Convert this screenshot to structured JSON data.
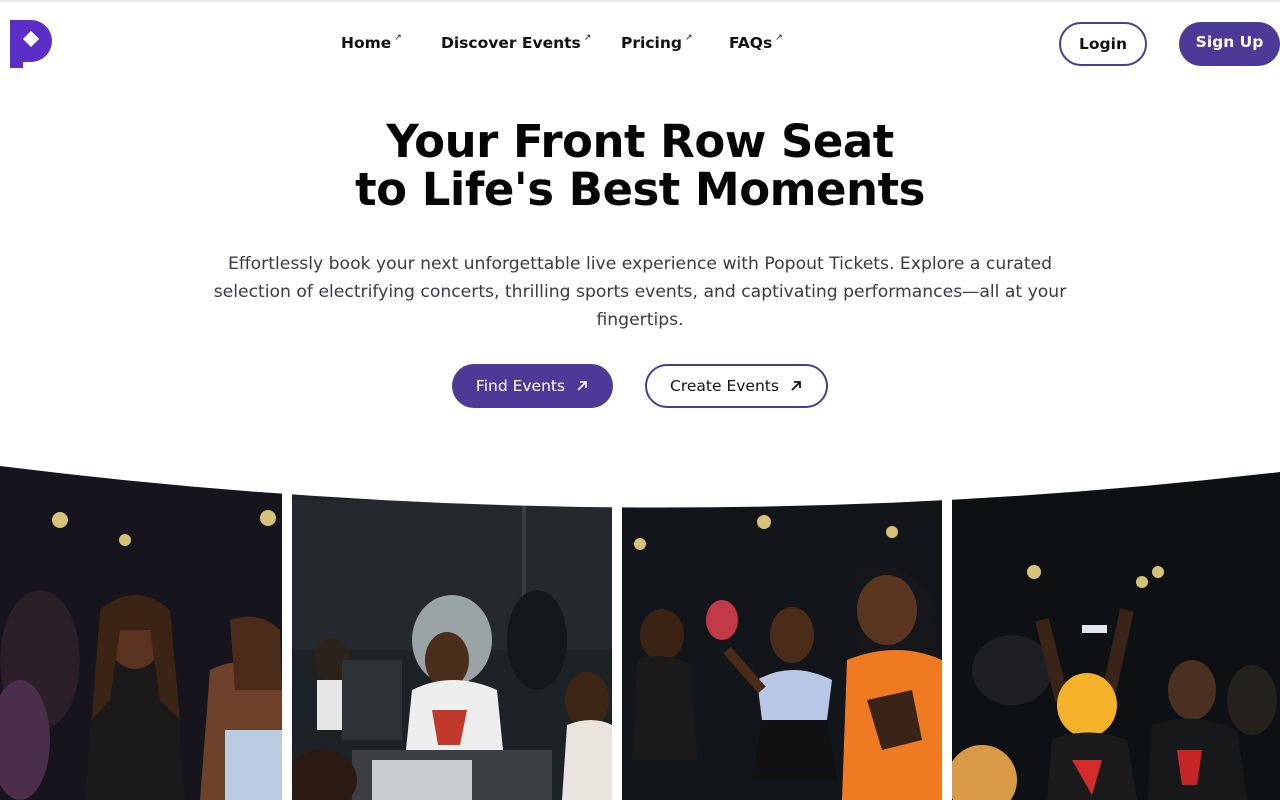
{
  "brand": {
    "color": "#4c3a96",
    "logo_icon": "popout-logo-icon"
  },
  "nav": {
    "items": [
      {
        "label": "Home",
        "arrow": "↗"
      },
      {
        "label": "Discover Events",
        "arrow": "↗"
      },
      {
        "label": "Pricing",
        "arrow": "↗"
      },
      {
        "label": "FAQs",
        "arrow": "↗"
      }
    ]
  },
  "auth": {
    "login_label": "Login",
    "signup_label": "Sign Up"
  },
  "hero": {
    "title_line1": "Your Front Row Seat",
    "title_line2": "to Life's Best Moments",
    "description": "Effortlessly book your next unforgettable live experience with Popout Tickets. Explore a curated selection of electrifying concerts, thrilling sports events, and captivating performances—all at your fingertips.",
    "find_events_label": "Find Events",
    "create_events_label": "Create Events"
  },
  "gallery": {
    "photos": [
      {
        "description": "crowd-dancing-photo"
      },
      {
        "description": "dj-performing-photo"
      },
      {
        "description": "dancers-photo"
      },
      {
        "description": "crowd-cheering-photo"
      }
    ]
  }
}
